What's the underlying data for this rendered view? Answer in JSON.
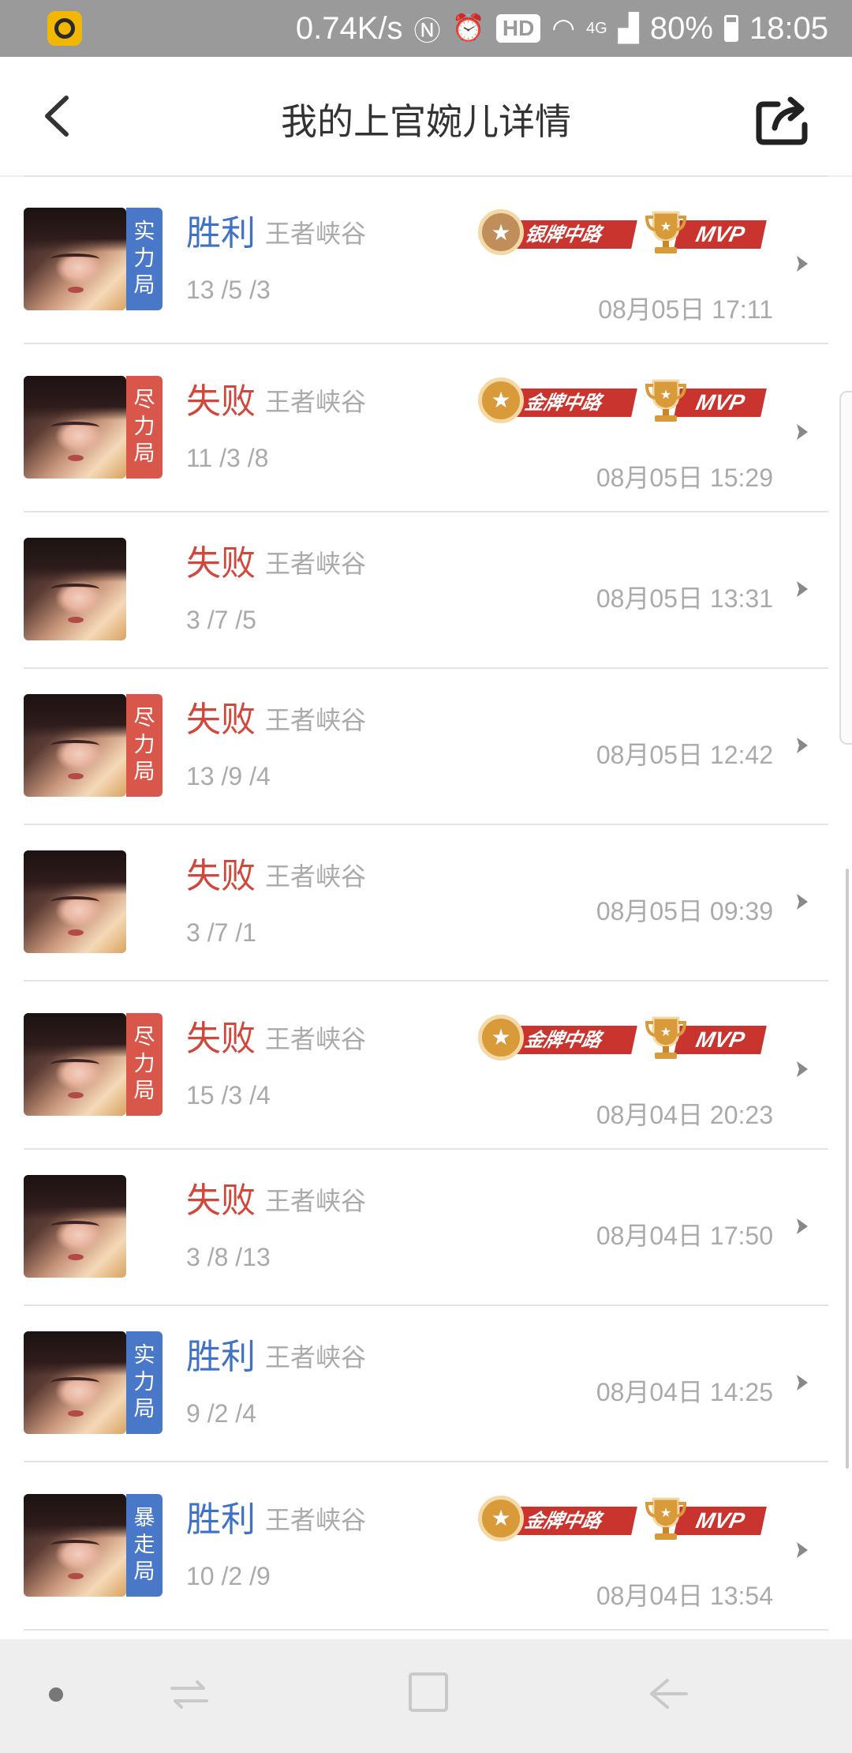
{
  "status_bar": {
    "speed": "0.74K/s",
    "hd": "HD",
    "network": "4G",
    "battery": "80%",
    "time": "18:05"
  },
  "header": {
    "title": "我的上官婉儿详情"
  },
  "matches": [
    {
      "result": "胜利",
      "result_type": "win",
      "mode": "王者峡谷",
      "kda": "13 /5 /3",
      "time": "08月05日 17:11",
      "tag": [
        "实",
        "力",
        "局"
      ],
      "tag_color": "blue",
      "medal": "银牌中路",
      "medal_type": "silver",
      "mvp": "MVP"
    },
    {
      "result": "失败",
      "result_type": "lose",
      "mode": "王者峡谷",
      "kda": "11 /3 /8",
      "time": "08月05日 15:29",
      "tag": [
        "尽",
        "力",
        "局"
      ],
      "tag_color": "red",
      "medal": "金牌中路",
      "medal_type": "gold",
      "mvp": "MVP"
    },
    {
      "result": "失败",
      "result_type": "lose",
      "mode": "王者峡谷",
      "kda": "3 /7 /5",
      "time": "08月05日 13:31",
      "tag": null
    },
    {
      "result": "失败",
      "result_type": "lose",
      "mode": "王者峡谷",
      "kda": "13 /9 /4",
      "time": "08月05日 12:42",
      "tag": [
        "尽",
        "力",
        "局"
      ],
      "tag_color": "red"
    },
    {
      "result": "失败",
      "result_type": "lose",
      "mode": "王者峡谷",
      "kda": "3 /7 /1",
      "time": "08月05日 09:39",
      "tag": null
    },
    {
      "result": "失败",
      "result_type": "lose",
      "mode": "王者峡谷",
      "kda": "15 /3 /4",
      "time": "08月04日 20:23",
      "tag": [
        "尽",
        "力",
        "局"
      ],
      "tag_color": "red",
      "medal": "金牌中路",
      "medal_type": "gold",
      "mvp": "MVP"
    },
    {
      "result": "失败",
      "result_type": "lose",
      "mode": "王者峡谷",
      "kda": "3 /8 /13",
      "time": "08月04日 17:50",
      "tag": null
    },
    {
      "result": "胜利",
      "result_type": "win",
      "mode": "王者峡谷",
      "kda": "9 /2 /4",
      "time": "08月04日 14:25",
      "tag": [
        "实",
        "力",
        "局"
      ],
      "tag_color": "blue"
    },
    {
      "result": "胜利",
      "result_type": "win",
      "mode": "王者峡谷",
      "kda": "10 /2 /9",
      "time": "08月04日 13:54",
      "tag": [
        "暴",
        "走",
        "局"
      ],
      "tag_color": "blue",
      "medal": "金牌中路",
      "medal_type": "gold",
      "mvp": "MVP"
    }
  ],
  "icons": {
    "back": "back-arrow-icon",
    "share": "share-icon",
    "row_arrow": "chevron-right-icon",
    "nav_recent": "recent-apps-icon",
    "nav_home": "home-icon",
    "nav_back": "back-icon"
  },
  "colors": {
    "win": "#3f72c4",
    "lose": "#d0473c",
    "tag_blue": "#4a78c9",
    "tag_red": "#d9574a",
    "ribbon": "#c9342e"
  }
}
